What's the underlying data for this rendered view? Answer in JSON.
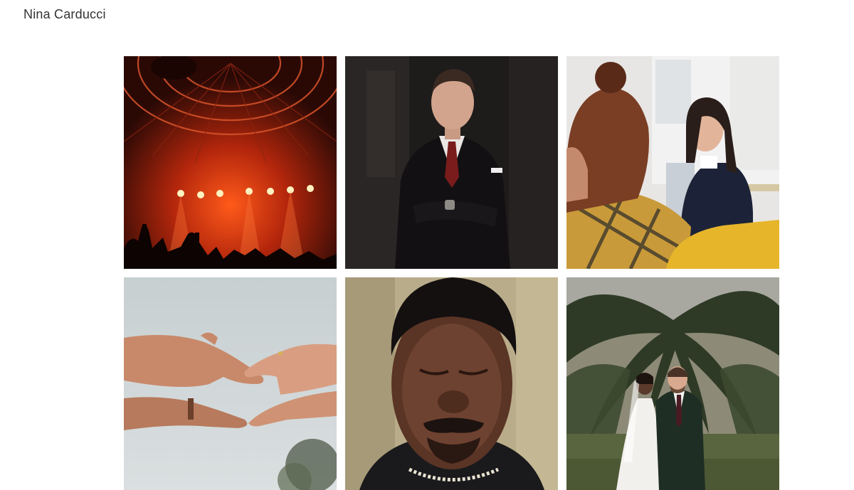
{
  "site": {
    "title": "Nina Carducci"
  },
  "gallery": {
    "items": [
      {
        "name": "concert-photo"
      },
      {
        "name": "businessman-portrait-photo"
      },
      {
        "name": "women-meeting-photo"
      },
      {
        "name": "hands-reaching-photo"
      },
      {
        "name": "man-portrait-photo"
      },
      {
        "name": "wedding-couple-photo"
      }
    ]
  }
}
